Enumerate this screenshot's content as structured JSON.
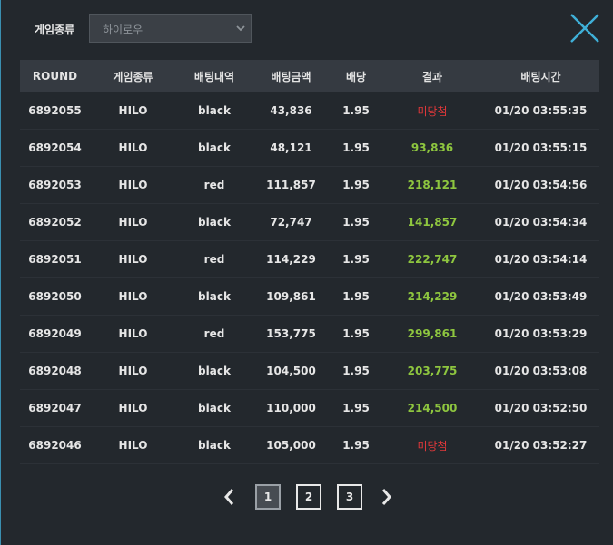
{
  "filter": {
    "label": "게임종류",
    "selected": "하이로우"
  },
  "table": {
    "headers": [
      "ROUND",
      "게임종류",
      "배팅내역",
      "배팅금액",
      "배당",
      "결과",
      "배팅시간"
    ],
    "rows": [
      {
        "round": "6892055",
        "game": "HILO",
        "bet": "black",
        "amount": "43,836",
        "odds": "1.95",
        "result": "미당첨",
        "status": "lose",
        "time": "01/20 03:55:35"
      },
      {
        "round": "6892054",
        "game": "HILO",
        "bet": "black",
        "amount": "48,121",
        "odds": "1.95",
        "result": "93,836",
        "status": "win",
        "time": "01/20 03:55:15"
      },
      {
        "round": "6892053",
        "game": "HILO",
        "bet": "red",
        "amount": "111,857",
        "odds": "1.95",
        "result": "218,121",
        "status": "win",
        "time": "01/20 03:54:56"
      },
      {
        "round": "6892052",
        "game": "HILO",
        "bet": "black",
        "amount": "72,747",
        "odds": "1.95",
        "result": "141,857",
        "status": "win",
        "time": "01/20 03:54:34"
      },
      {
        "round": "6892051",
        "game": "HILO",
        "bet": "red",
        "amount": "114,229",
        "odds": "1.95",
        "result": "222,747",
        "status": "win",
        "time": "01/20 03:54:14"
      },
      {
        "round": "6892050",
        "game": "HILO",
        "bet": "black",
        "amount": "109,861",
        "odds": "1.95",
        "result": "214,229",
        "status": "win",
        "time": "01/20 03:53:49"
      },
      {
        "round": "6892049",
        "game": "HILO",
        "bet": "red",
        "amount": "153,775",
        "odds": "1.95",
        "result": "299,861",
        "status": "win",
        "time": "01/20 03:53:29"
      },
      {
        "round": "6892048",
        "game": "HILO",
        "bet": "black",
        "amount": "104,500",
        "odds": "1.95",
        "result": "203,775",
        "status": "win",
        "time": "01/20 03:53:08"
      },
      {
        "round": "6892047",
        "game": "HILO",
        "bet": "black",
        "amount": "110,000",
        "odds": "1.95",
        "result": "214,500",
        "status": "win",
        "time": "01/20 03:52:50"
      },
      {
        "round": "6892046",
        "game": "HILO",
        "bet": "black",
        "amount": "105,000",
        "odds": "1.95",
        "result": "미당첨",
        "status": "lose",
        "time": "01/20 03:52:27"
      }
    ]
  },
  "pagination": {
    "pages": [
      "1",
      "2",
      "3"
    ],
    "current": "1"
  },
  "colors": {
    "win": "#8ec63f",
    "lose": "#e2383a",
    "accent": "#3a8fb0"
  },
  "icons": {
    "close": "close-icon",
    "prev": "chevron-left-icon",
    "next": "chevron-right-icon",
    "dropdown": "chevron-down-icon"
  }
}
